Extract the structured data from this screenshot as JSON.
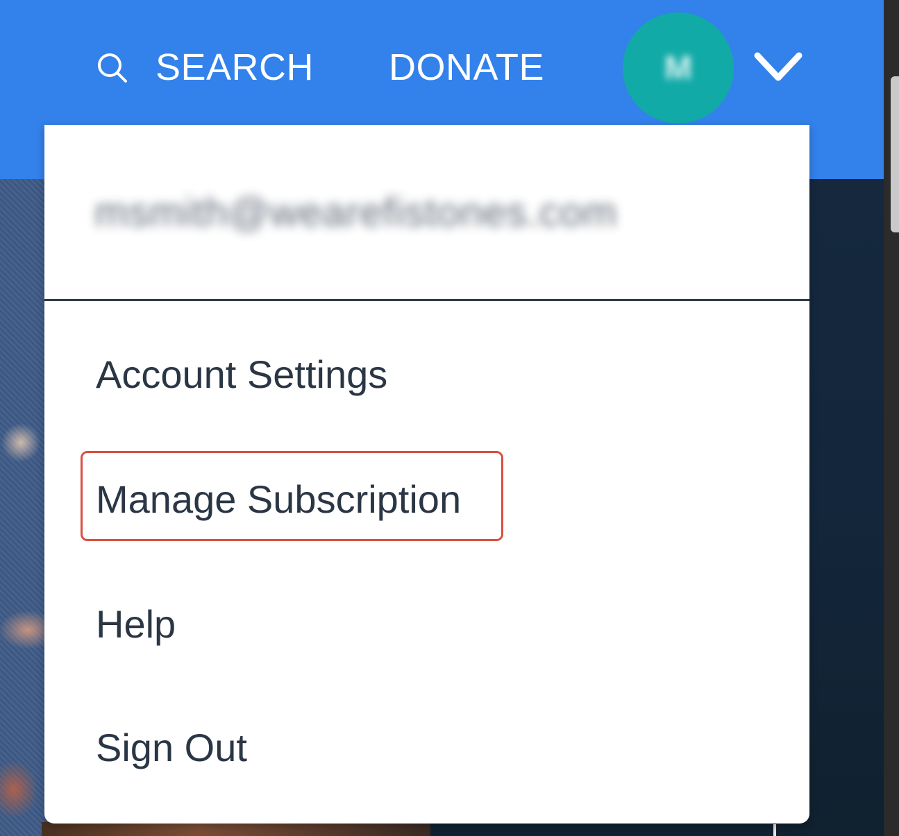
{
  "nav": {
    "search_label": "SEARCH",
    "donate_label": "DONATE",
    "search_icon": "search-icon",
    "chevron_icon": "chevron-down-icon",
    "background_color": "#3381ea"
  },
  "account": {
    "avatar_initial": "M",
    "avatar_color": "#12aaa7",
    "email": "msmith@wearefistones.com"
  },
  "menu": {
    "items": [
      {
        "label": "Account Settings"
      },
      {
        "label": "Manage Subscription",
        "highlighted": true
      },
      {
        "label": "Help"
      },
      {
        "label": "Sign Out"
      }
    ],
    "highlight_color": "#d9503f"
  }
}
